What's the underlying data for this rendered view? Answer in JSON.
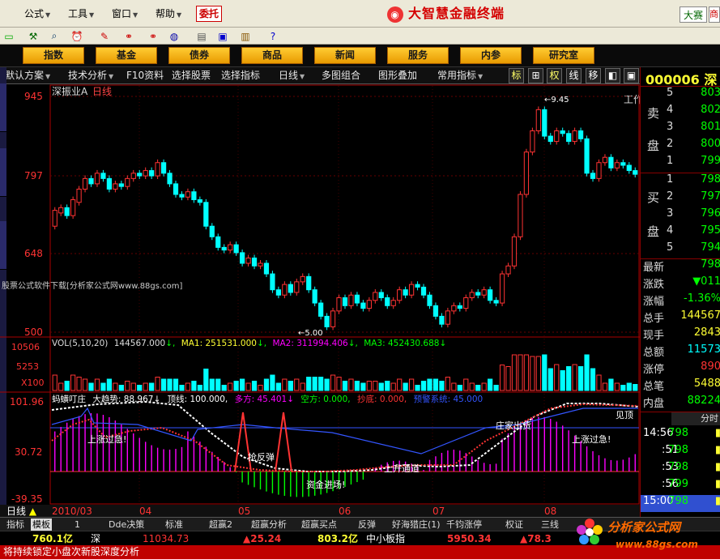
{
  "menu": {
    "items": [
      {
        "label": "公式"
      },
      {
        "label": "工具"
      },
      {
        "label": "窗口"
      },
      {
        "label": "帮助"
      }
    ],
    "entrust": "委托",
    "brand": "大智慧金融终端",
    "contest": "大赛"
  },
  "nav_tabs": [
    "指数",
    "基金",
    "债券",
    "商品",
    "新闻",
    "服务",
    "内参",
    "研究室"
  ],
  "workarea": "工作区",
  "subbar": {
    "items": [
      "默认方案",
      "技术分析",
      "F10资料",
      "选择股票",
      "选择指标",
      "日线",
      "多图组合",
      "图形叠加",
      "常用指标"
    ],
    "buttons": [
      "标",
      "⊞",
      "权",
      "线",
      "移",
      "◧",
      "▣"
    ]
  },
  "chart": {
    "stock_name": "深振业A",
    "period": "日线",
    "price_ticks": [
      "945",
      "797",
      "648",
      "500"
    ],
    "vol_ticks": [
      "10506",
      "5253",
      "X100"
    ],
    "ind_ticks": [
      "101.96",
      "30.72",
      "-39.35"
    ],
    "dates": [
      "2010/03",
      "04",
      "05",
      "06",
      "07",
      "08"
    ],
    "high_label": "9.45",
    "low_label": "5.00",
    "watermark": "股票公式软件下载[分析家公式网www.88gs.com]",
    "vol_legend": {
      "prefix": "VOL(5,10,20)",
      "vol": "144567.000",
      "ma1": "MA1: 251531.000",
      "ma2": "MA2: 311994.406",
      "ma3": "MA3: 452430.688"
    },
    "ind_legend": [
      {
        "text": "蚂蟥叮庄",
        "color": "#ffffff"
      },
      {
        "text": "大趋势: 88.967↓",
        "color": "#ffffff"
      },
      {
        "text": "顶线: 100.000,",
        "color": "#ffffff"
      },
      {
        "text": "多方: 45.401↓",
        "color": "#ff00ff"
      },
      {
        "text": "空方: 0.000,",
        "color": "#00ff00"
      },
      {
        "text": "抄底: 0.000,",
        "color": "#ff3333"
      },
      {
        "text": "预警系统: 45.000",
        "color": "#3355ff"
      }
    ],
    "annotations": [
      "上涨过急!",
      "抢反弹",
      "资金进场!",
      "上升通道",
      "庄家出货",
      "见顶",
      "上涨过急!"
    ],
    "bottom_label": "日线"
  },
  "chart_data": {
    "type": "candlestick",
    "ylim": [
      500,
      945
    ],
    "candles": [
      {
        "o": 700,
        "c": 730
      },
      {
        "o": 725,
        "c": 735
      },
      {
        "o": 735,
        "c": 720
      },
      {
        "o": 720,
        "c": 750
      },
      {
        "o": 745,
        "c": 770
      },
      {
        "o": 770,
        "c": 790
      },
      {
        "o": 790,
        "c": 780
      },
      {
        "o": 780,
        "c": 800
      },
      {
        "o": 800,
        "c": 790
      },
      {
        "o": 790,
        "c": 770
      },
      {
        "o": 770,
        "c": 780
      },
      {
        "o": 780,
        "c": 775
      },
      {
        "o": 775,
        "c": 790
      },
      {
        "o": 790,
        "c": 800
      },
      {
        "o": 800,
        "c": 795
      },
      {
        "o": 795,
        "c": 805
      },
      {
        "o": 805,
        "c": 795
      },
      {
        "o": 795,
        "c": 820
      },
      {
        "o": 820,
        "c": 800
      },
      {
        "o": 800,
        "c": 780
      },
      {
        "o": 780,
        "c": 760
      },
      {
        "o": 760,
        "c": 755
      },
      {
        "o": 755,
        "c": 765
      },
      {
        "o": 765,
        "c": 750
      },
      {
        "o": 750,
        "c": 745
      },
      {
        "o": 745,
        "c": 700
      },
      {
        "o": 700,
        "c": 680
      },
      {
        "o": 680,
        "c": 660
      },
      {
        "o": 660,
        "c": 655
      },
      {
        "o": 655,
        "c": 665
      },
      {
        "o": 665,
        "c": 650
      },
      {
        "o": 650,
        "c": 630
      },
      {
        "o": 630,
        "c": 640
      },
      {
        "o": 640,
        "c": 625
      },
      {
        "o": 625,
        "c": 630
      },
      {
        "o": 630,
        "c": 610
      },
      {
        "o": 610,
        "c": 580
      },
      {
        "o": 580,
        "c": 570
      },
      {
        "o": 570,
        "c": 590
      },
      {
        "o": 590,
        "c": 575
      },
      {
        "o": 575,
        "c": 595
      },
      {
        "o": 595,
        "c": 605
      },
      {
        "o": 605,
        "c": 580
      },
      {
        "o": 580,
        "c": 555
      },
      {
        "o": 555,
        "c": 530
      },
      {
        "o": 530,
        "c": 510
      },
      {
        "o": 510,
        "c": 540
      },
      {
        "o": 540,
        "c": 565
      },
      {
        "o": 565,
        "c": 550
      },
      {
        "o": 550,
        "c": 570
      },
      {
        "o": 570,
        "c": 555
      },
      {
        "o": 555,
        "c": 545
      },
      {
        "o": 545,
        "c": 560
      },
      {
        "o": 560,
        "c": 575
      },
      {
        "o": 575,
        "c": 565
      },
      {
        "o": 565,
        "c": 550
      },
      {
        "o": 550,
        "c": 560
      },
      {
        "o": 560,
        "c": 580
      },
      {
        "o": 580,
        "c": 570
      },
      {
        "o": 570,
        "c": 590
      },
      {
        "o": 590,
        "c": 585
      },
      {
        "o": 585,
        "c": 570
      },
      {
        "o": 570,
        "c": 550
      },
      {
        "o": 550,
        "c": 530
      },
      {
        "o": 530,
        "c": 515
      },
      {
        "o": 515,
        "c": 540
      },
      {
        "o": 540,
        "c": 550
      },
      {
        "o": 550,
        "c": 545
      },
      {
        "o": 545,
        "c": 565
      },
      {
        "o": 565,
        "c": 575
      },
      {
        "o": 575,
        "c": 570
      },
      {
        "o": 570,
        "c": 580
      },
      {
        "o": 580,
        "c": 560
      },
      {
        "o": 560,
        "c": 555
      },
      {
        "o": 555,
        "c": 610
      },
      {
        "o": 610,
        "c": 625
      },
      {
        "o": 625,
        "c": 680
      },
      {
        "o": 680,
        "c": 760
      },
      {
        "o": 760,
        "c": 840
      },
      {
        "o": 840,
        "c": 880
      },
      {
        "o": 880,
        "c": 920
      },
      {
        "o": 920,
        "c": 870
      },
      {
        "o": 870,
        "c": 860
      },
      {
        "o": 860,
        "c": 880
      },
      {
        "o": 880,
        "c": 875
      },
      {
        "o": 875,
        "c": 860
      },
      {
        "o": 860,
        "c": 880
      },
      {
        "o": 880,
        "c": 865
      },
      {
        "o": 865,
        "c": 800
      },
      {
        "o": 800,
        "c": 790
      },
      {
        "o": 790,
        "c": 820
      },
      {
        "o": 820,
        "c": 830
      },
      {
        "o": 830,
        "c": 810
      },
      {
        "o": 810,
        "c": 820
      },
      {
        "o": 820,
        "c": 815
      },
      {
        "o": 815,
        "c": 805
      },
      {
        "o": 805,
        "c": 798
      }
    ]
  },
  "right_panel": {
    "code": "000006 深",
    "ask_label": [
      "卖",
      "盘"
    ],
    "bid_label": [
      "买",
      "盘"
    ],
    "asks": [
      {
        "n": "5",
        "v": "803"
      },
      {
        "n": "4",
        "v": "802"
      },
      {
        "n": "3",
        "v": "801"
      },
      {
        "n": "2",
        "v": "800"
      },
      {
        "n": "1",
        "v": "799"
      }
    ],
    "bids": [
      {
        "n": "1",
        "v": "798"
      },
      {
        "n": "2",
        "v": "797"
      },
      {
        "n": "3",
        "v": "796"
      },
      {
        "n": "4",
        "v": "795"
      },
      {
        "n": "5",
        "v": "794"
      }
    ],
    "quote": [
      {
        "label": "最新",
        "value": "798",
        "color": "#00ff00"
      },
      {
        "label": "涨跌",
        "value": "▼011",
        "color": "#00ff00"
      },
      {
        "label": "涨幅",
        "value": "-1.36%",
        "color": "#00ff00"
      },
      {
        "label": "总手",
        "value": "144567",
        "color": "#ffff33"
      },
      {
        "label": "现手",
        "value": "2843",
        "color": "#ffff33"
      },
      {
        "label": "总额",
        "value": "11573",
        "color": "#00ffff"
      },
      {
        "label": "涨停",
        "value": "890",
        "color": "#ff3333"
      },
      {
        "label": "总笔",
        "value": "5488",
        "color": "#ffff33"
      },
      {
        "label": "内盘",
        "value": "88224",
        "color": "#00ff00"
      }
    ],
    "fenshi": "分时",
    "ticks": [
      {
        "t": "14:56",
        "v": "798"
      },
      {
        "t": ":51",
        "v": "798"
      },
      {
        "t": ":53",
        "v": "798"
      },
      {
        "t": ":56",
        "v": "799"
      },
      {
        "t": "15:00",
        "v": "798"
      }
    ]
  },
  "bottom_tabs": [
    "指标",
    "模板",
    "1",
    "Dde决策",
    "标准",
    "超赢2",
    "超赢分析",
    "超赢买点",
    "反弹",
    "好海猎庄(1)",
    "千钧涨停",
    "权证",
    "三线"
  ],
  "bottom_quotes": [
    {
      "text": "760.1亿",
      "color": "#ffff33"
    },
    {
      "text": "深",
      "color": "#ffffff"
    },
    {
      "text": "11034.73",
      "color": "#ff3333"
    },
    {
      "text": "▲25.24",
      "color": "#ff3333"
    },
    {
      "text": "803.2亿",
      "color": "#ffff33"
    },
    {
      "text": "中小板指",
      "color": "#ffffff"
    },
    {
      "text": "5950.34",
      "color": "#ff3333"
    },
    {
      "text": "▲78.3",
      "color": "#ff3333"
    }
  ],
  "ticker": "将持续锁定小盘次新股深度分析",
  "brand_watermark": {
    "cn": "分析家公式网",
    "url": "www.88gs.com"
  }
}
